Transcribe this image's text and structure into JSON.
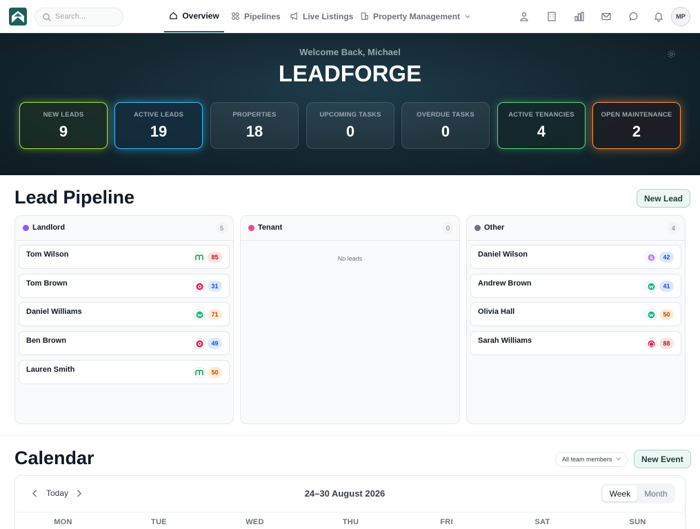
{
  "topnav": {
    "search_placeholder": "Search...",
    "tabs": [
      {
        "label": "Overview",
        "icon": "home-icon",
        "active": true
      },
      {
        "label": "Pipelines",
        "icon": "grid-icon"
      },
      {
        "label": "Live Listings",
        "icon": "megaphone-icon"
      },
      {
        "label": "Property Management",
        "icon": "building-icon"
      }
    ],
    "toolbar_icons": [
      "user-network-icon",
      "building-icon",
      "bar-chart-icon",
      "mail-icon",
      "chat-icon",
      "bell-icon"
    ],
    "avatar_initials": "MP"
  },
  "hero": {
    "welcome": "Welcome Back, Michael",
    "brand": "LEADFORGE",
    "stats": [
      {
        "label": "NEW LEADS",
        "value": "9",
        "glow": "#a3e635"
      },
      {
        "label": "ACTIVE LEADS",
        "value": "19",
        "glow": "#38bdf8"
      },
      {
        "label": "PROPERTIES",
        "value": "18"
      },
      {
        "label": "UPCOMING TASKS",
        "value": "0"
      },
      {
        "label": "OVERDUE TASKS",
        "value": "0"
      },
      {
        "label": "ACTIVE TENANCIES",
        "value": "4",
        "glow": "#4ade80"
      },
      {
        "label": "OPEN MAINTENANCE",
        "value": "2",
        "glow": "#fb923c"
      }
    ]
  },
  "pipeline": {
    "title": "Lead Pipeline",
    "new_lead_label": "New Lead",
    "columns": [
      {
        "title": "Landlord",
        "count": "5",
        "dot": "#8b5cf6",
        "leads": [
          {
            "name": "Tom Wilson",
            "source": "m",
            "score": "85"
          },
          {
            "name": "Tom Brown",
            "source": "o",
            "score": "31"
          },
          {
            "name": "Daniel Williams",
            "source": "w",
            "score": "71"
          },
          {
            "name": "Ben Brown",
            "source": "o",
            "score": "49"
          },
          {
            "name": "Lauren Smith",
            "source": "m",
            "score": "50"
          }
        ]
      },
      {
        "title": "Tenant",
        "count": "0",
        "dot": "#ec4899",
        "empty_text": "No leads",
        "leads": []
      },
      {
        "title": "Other",
        "count": "4",
        "dot": "#6b7280",
        "leads": [
          {
            "name": "Daniel Wilson",
            "source": "s",
            "score": "42"
          },
          {
            "name": "Andrew Brown",
            "source": "w",
            "score": "41"
          },
          {
            "name": "Olivia Hall",
            "source": "w",
            "score": "50"
          },
          {
            "name": "Sarah Williams",
            "source": "r",
            "score": "88"
          }
        ]
      }
    ]
  },
  "calendar": {
    "title": "Calendar",
    "filter_label": "All team members",
    "new_event_label": "New Event",
    "today_label": "Today",
    "range_label": "24–30 August 2026",
    "views": [
      "Week",
      "Month"
    ],
    "active_view": "Week",
    "days": [
      "MON",
      "TUE",
      "WED",
      "THU",
      "FRI",
      "SAT",
      "SUN"
    ]
  },
  "colors": {
    "accent": "#1f5f5b",
    "score_high": "#fee2e2",
    "score_mid": "#ffedd5",
    "score_low": "#dbeafe"
  }
}
